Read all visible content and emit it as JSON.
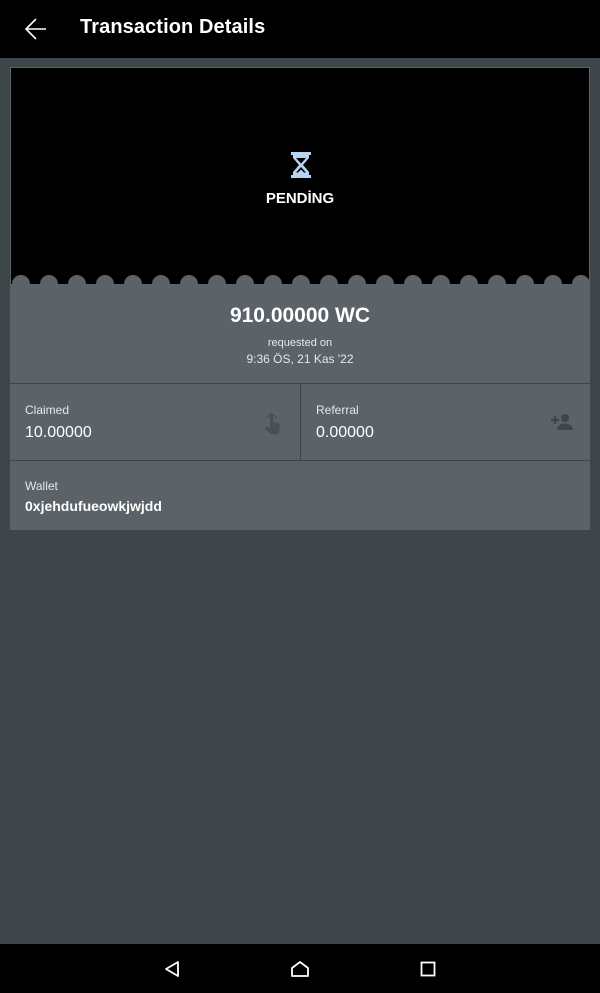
{
  "header": {
    "title": "Transaction Details",
    "back_icon": "arrow-left-icon"
  },
  "status": {
    "label": "PENDİNG",
    "icon": "hourglass-icon",
    "icon_color": "#b9d4f0"
  },
  "transaction": {
    "amount": "910.00000 WC",
    "requested_label": "requested on",
    "requested_date": "9:36 ÖS, 21 Kas '22"
  },
  "claimed": {
    "label": "Claimed",
    "value": "10.00000",
    "icon": "touch-hand-icon"
  },
  "referral": {
    "label": "Referral",
    "value": "0.00000",
    "icon": "add-person-icon"
  },
  "wallet": {
    "label": "Wallet",
    "value": "0xjehdufueowkjwjdd"
  },
  "navbar": {
    "back_icon": "nav-back-icon",
    "home_icon": "nav-home-icon",
    "recents_icon": "nav-recents-icon"
  },
  "colors": {
    "background": "#3e4649",
    "card": "#5b6369",
    "black": "#000000"
  }
}
